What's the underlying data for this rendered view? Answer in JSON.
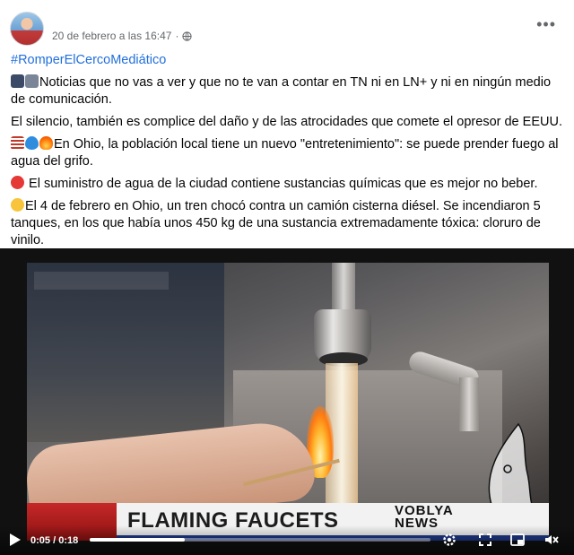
{
  "post": {
    "date": "20 de febrero a las 16:47",
    "separator": "·",
    "privacy_icon": "globe-icon",
    "more_icon": "more-options-icon",
    "hashtag": "#RomperElCercoMediático",
    "paragraphs": [
      {
        "emojis": [
          "tv-icon",
          "radio-icon"
        ],
        "text": "Noticias que no vas a ver y que no te van a contar en TN ni en LN+ y ni en ningún medio de comunicación."
      },
      {
        "emojis": [],
        "text": "El silencio, también es complice del daño y de las atrocidades que comete el opresor de EEUU."
      },
      {
        "emojis": [
          "us-flag-icon",
          "droplet-icon",
          "fire-icon"
        ],
        "text": "En Ohio, la población local tiene un nuevo \"entretenimiento\": se puede prender fuego al agua del grifo."
      },
      {
        "emojis": [
          "non-potable-water-icon"
        ],
        "text": " El suministro de agua de la ciudad contiene sustancias químicas que es mejor no beber."
      },
      {
        "emojis": [
          "grinning-face-icon"
        ],
        "text": "El 4 de febrero en Ohio, un tren chocó contra un camión cisterna diésel. Se incendiaron 5 tanques, en los que había unos 450 kg de una sustancia extremadamente tóxica: cloruro de vinilo."
      }
    ]
  },
  "video": {
    "headline": "FLAMING FAUCETS",
    "watermark_line1": "VOBLYA",
    "watermark_line2": "NEWS",
    "current_time": "0:05",
    "duration": "0:18",
    "time_separator": " / ",
    "progress": 0.28,
    "controls": [
      "play-icon",
      "settings-icon",
      "fullscreen-expand-icon",
      "picture-in-picture-icon",
      "volume-muted-icon"
    ]
  }
}
